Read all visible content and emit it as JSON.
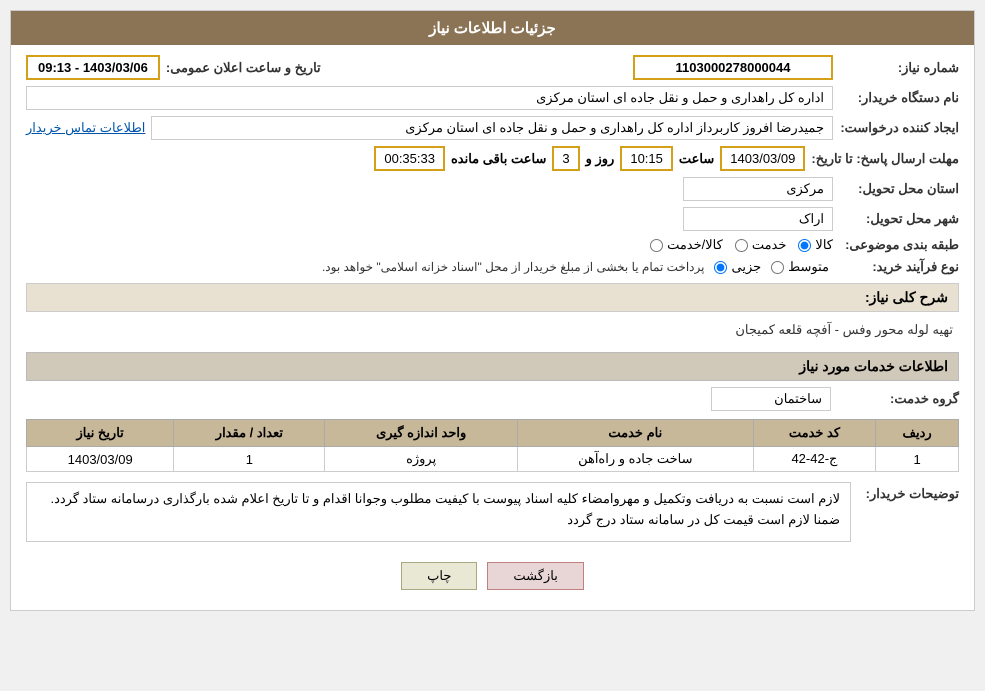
{
  "header": {
    "title": "جزئیات اطلاعات نیاز"
  },
  "fields": {
    "need_number_label": "شماره نیاز:",
    "need_number_value": "1103000278000044",
    "announce_datetime_label": "تاریخ و ساعت اعلان عمومی:",
    "announce_datetime_value": "1403/03/06 - 09:13",
    "buyer_org_label": "نام دستگاه خریدار:",
    "buyer_org_value": "اداره کل راهداری و حمل و نقل جاده ای استان مرکزی",
    "creator_label": "ایجاد کننده درخواست:",
    "creator_value": "جمیدرضا  افروز  کاربرداز اداره کل راهداری و حمل و نقل جاده ای استان مرکزی",
    "contact_link": "اطلاعات تماس خریدار",
    "response_deadline_label": "مهلت ارسال پاسخ: تا تاریخ:",
    "response_date_value": "1403/03/09",
    "response_time_label": "ساعت",
    "response_time_value": "10:15",
    "response_day_label": "روز و",
    "response_day_value": "3",
    "remaining_time_label": "ساعت باقی مانده",
    "remaining_time_value": "00:35:33",
    "province_label": "استان محل تحویل:",
    "province_value": "مرکزی",
    "city_label": "شهر محل تحویل:",
    "city_value": "اراک",
    "category_label": "طبقه بندی موضوعی:",
    "category_options": [
      "کالا",
      "خدمت",
      "کالا/خدمت"
    ],
    "category_selected": "کالا",
    "process_label": "نوع فرآیند خرید:",
    "process_options": [
      "جزیی",
      "متوسط"
    ],
    "process_note": "پرداخت تمام یا بخشی از مبلغ خریدار از محل \"اسناد خزانه اسلامی\" خواهد بود.",
    "need_description_label": "شرح کلی نیاز:",
    "need_description_value": "تهیه لوله محور وفس - آفچه قلعه کمیجان",
    "service_info_header": "اطلاعات خدمات مورد نیاز",
    "service_group_label": "گروه خدمت:",
    "service_group_value": "ساختمان",
    "table": {
      "headers": [
        "ردیف",
        "کد خدمت",
        "نام خدمت",
        "واحد اندازه گیری",
        "تعداد / مقدار",
        "تاریخ نیاز"
      ],
      "rows": [
        {
          "index": "1",
          "code": "ج-42-42",
          "name": "ساخت جاده و راه‌آهن",
          "unit": "پروژه",
          "quantity": "1",
          "date": "1403/03/09"
        }
      ]
    },
    "buyer_notes_label": "توضیحات خریدار:",
    "buyer_notes_value": "لازم است نسبت به دریافت وتکمیل و مهروامضاء کلیه اسناد پیوست با کیفیت مطلوب وجوانا اقدام و تا تاریخ اعلام شده بارگذاری درسامانه ستاد گردد. ضمنا لازم است قیمت کل در سامانه ستاد درج گردد",
    "btn_back": "بازگشت",
    "btn_print": "چاپ"
  }
}
